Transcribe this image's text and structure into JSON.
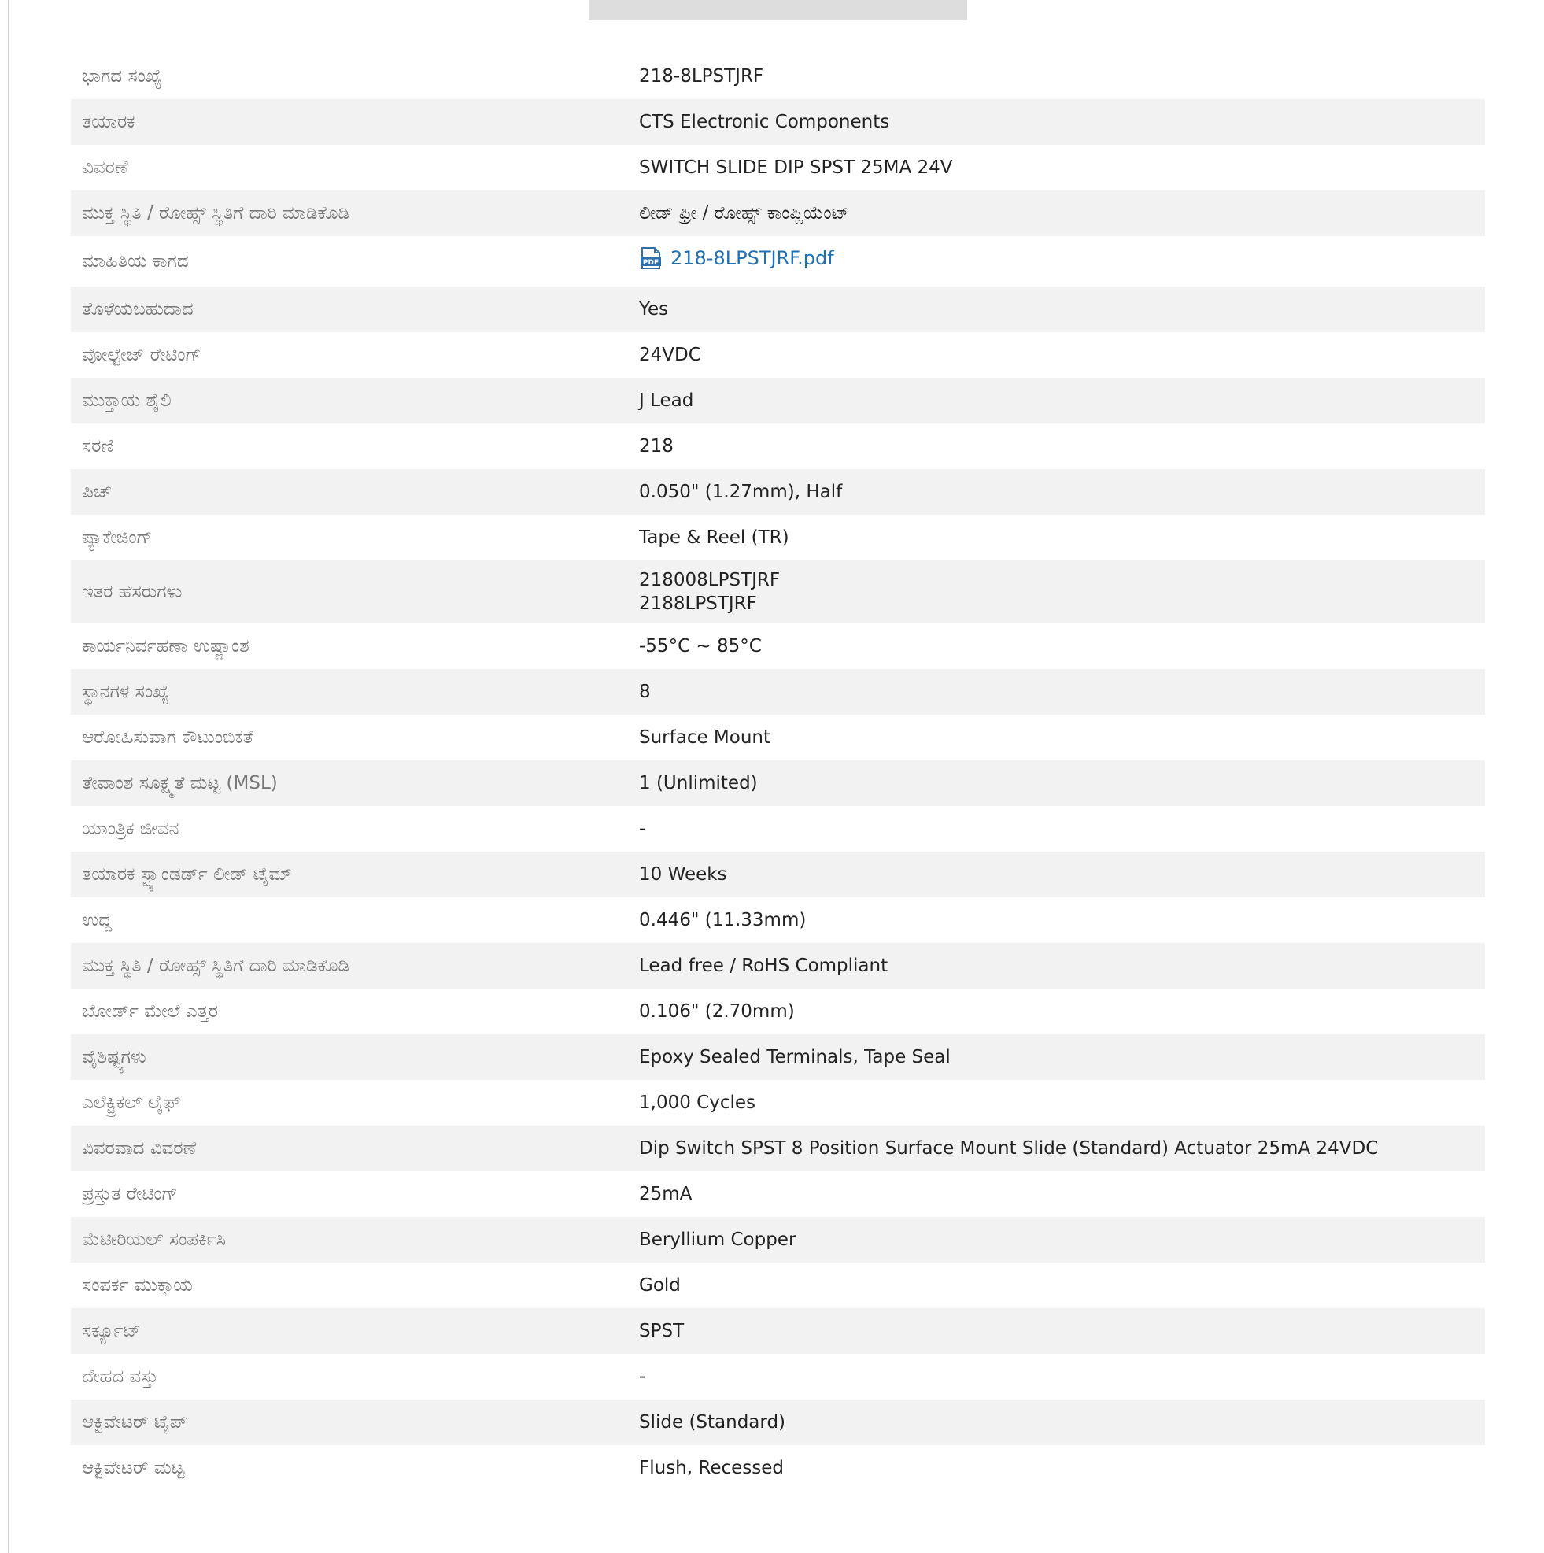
{
  "specs": [
    {
      "label": "ಭಾಗದ ಸಂಖ್ಯೆ",
      "value": "218-8LPSTJRF"
    },
    {
      "label": "ತಯಾರಕ",
      "value": "CTS Electronic Components"
    },
    {
      "label": "ವಿವರಣೆ",
      "value": "SWITCH SLIDE DIP SPST 25MA 24V"
    },
    {
      "label": "ಮುಕ್ತ ಸ್ಥಿತಿ / ರೋಹ್ಸ್ ಸ್ಥಿತಿಗೆ ದಾರಿ ಮಾಡಿಕೊಡಿ",
      "value": "ಲೀಡ್ ಫ್ರೀ / ರೋಹ್ಸ್ ಕಾಂಪ್ಲಿಯೆಂಟ್"
    },
    {
      "label": "ಮಾಹಿತಿಯ ಕಾಗದ",
      "value": "218-8LPSTJRF.pdf"
    },
    {
      "label": "ತೊಳೆಯಬಹುದಾದ",
      "value": "Yes"
    },
    {
      "label": "ವೋಲ್ಟೇಜ್ ರೇಟಿಂಗ್",
      "value": "24VDC"
    },
    {
      "label": "ಮುಕ್ತಾಯ ಶೈಲಿ",
      "value": "J Lead"
    },
    {
      "label": "ಸರಣಿ",
      "value": "218"
    },
    {
      "label": "ಪಿಚ್",
      "value": "0.050\" (1.27mm), Half"
    },
    {
      "label": "ಪ್ಯಾಕೇಜಿಂಗ್",
      "value": "Tape & Reel (TR)"
    },
    {
      "label": "ಇತರ ಹೆಸರುಗಳು",
      "values": [
        "218008LPSTJRF",
        "2188LPSTJRF"
      ]
    },
    {
      "label": "ಕಾರ್ಯನಿರ್ವಹಣಾ ಉಷ್ಣಾಂಶ",
      "value": "-55°C ~ 85°C"
    },
    {
      "label": "ಸ್ಥಾನಗಳ ಸಂಖ್ಯೆ",
      "value": "8"
    },
    {
      "label": "ಆರೋಹಿಸುವಾಗ ಕೌಟುಂಬಿಕತೆ",
      "value": "Surface Mount"
    },
    {
      "label": "ತೇವಾಂಶ ಸೂಕ್ಷ್ಮತೆ ಮಟ್ಟ (MSL)",
      "value": "1 (Unlimited)"
    },
    {
      "label": "ಯಾಂತ್ರಿಕ ಜೀವನ",
      "value": "-"
    },
    {
      "label": "ತಯಾರಕ ಸ್ಟ್ಯಾಂಡರ್ಡ್ ಲೀಡ್ ಟೈಮ್",
      "value": "10 Weeks"
    },
    {
      "label": "ಉದ್ದ",
      "value": "0.446\" (11.33mm)"
    },
    {
      "label": "ಮುಕ್ತ ಸ್ಥಿತಿ / ರೋಹ್ಸ್ ಸ್ಥಿತಿಗೆ ದಾರಿ ಮಾಡಿಕೊಡಿ",
      "value": "Lead free / RoHS Compliant"
    },
    {
      "label": "ಬೋರ್ಡ್ ಮೇಲೆ ಎತ್ತರ",
      "value": "0.106\" (2.70mm)"
    },
    {
      "label": "ವೈಶಿಷ್ಟ್ಯಗಳು",
      "value": "Epoxy Sealed Terminals, Tape Seal"
    },
    {
      "label": "ಎಲೆಕ್ಟ್ರಿಕಲ್ ಲೈಫ್",
      "value": "1,000 Cycles"
    },
    {
      "label": "ವಿವರವಾದ ವಿವರಣೆ",
      "value": "Dip Switch SPST 8 Position Surface Mount Slide (Standard) Actuator 25mA 24VDC"
    },
    {
      "label": "ಪ್ರಸ್ತುತ ರೇಟಿಂಗ್",
      "value": "25mA"
    },
    {
      "label": "ಮೆಟೀರಿಯಲ್ ಸಂಪರ್ಕಿಸಿ",
      "value": "Beryllium Copper"
    },
    {
      "label": "ಸಂಪರ್ಕ ಮುಕ್ತಾಯ",
      "value": "Gold"
    },
    {
      "label": "ಸರ್ಕ್ಯೂಟ್",
      "value": "SPST"
    },
    {
      "label": "ದೇಹದ ವಸ್ತು",
      "value": "-"
    },
    {
      "label": "ಆಕ್ಟಿವೇಟರ್ ಟೈಪ್",
      "value": "Slide (Standard)"
    },
    {
      "label": "ಆಕ್ಟಿವೇಟರ್ ಮಟ್ಟ",
      "value": "Flush, Recessed"
    }
  ],
  "datasheet": {
    "icon": "pdf-file-icon",
    "icon_text": "PDF"
  },
  "colors": {
    "label_text": "#777777",
    "value_text": "#222222",
    "stripe_bg": "#f2f2f2",
    "link": "#1d6fb8"
  }
}
